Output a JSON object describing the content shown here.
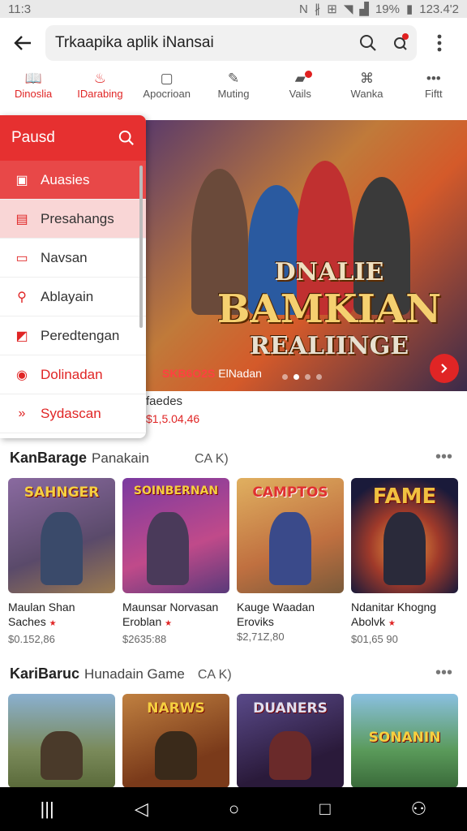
{
  "status": {
    "time": "11:3",
    "battery": "19%",
    "clock": "123.4'2"
  },
  "search": {
    "value": "Trkaapika aplik iNansai"
  },
  "tabs": [
    {
      "label": "Dinoslia",
      "icon": "book-icon"
    },
    {
      "label": "IDarabing",
      "icon": "flame-icon"
    },
    {
      "label": "Apocrioan",
      "icon": "square-icon"
    },
    {
      "label": "Muting",
      "icon": "pen-icon"
    },
    {
      "label": "Vails",
      "icon": "bag-icon"
    },
    {
      "label": "Wanka",
      "icon": "controller-icon"
    },
    {
      "label": "Fiftt",
      "icon": "more-icon"
    }
  ],
  "drawer": {
    "title": "Pausd",
    "items": [
      {
        "label": "Auasies",
        "icon": "document-icon"
      },
      {
        "label": "Presahangs",
        "icon": "tag-icon"
      },
      {
        "label": "Navsan",
        "icon": "folder-icon"
      },
      {
        "label": "Ablayain",
        "icon": "link-icon"
      },
      {
        "label": "Peredtengan",
        "icon": "chart-icon"
      },
      {
        "label": "Dolinadan",
        "icon": "record-icon"
      },
      {
        "label": "Sydascan",
        "icon": "arrows-icon"
      }
    ]
  },
  "hero": {
    "line1": "DNALIE",
    "line2": "BAMKIAN",
    "line3": "REALIINGE",
    "caption_red": "SKB6O2S",
    "caption": "ElNadan",
    "behind_text": "faedes",
    "behind_price": "$1,5.04,46",
    "colors": {
      "accent": "#e02525"
    }
  },
  "sections": [
    {
      "title": "KanBarage",
      "subtitle": "Panakain",
      "tag": "CA K)",
      "cards": [
        {
          "img_text": "SAHNGER",
          "name1": "Maulan  Shan",
          "name2": "Saches",
          "price": "$0.152,86",
          "bg": "#7a5a8a"
        },
        {
          "img_text": "SOINBERNAN",
          "name1": "Maunsar Norvasan",
          "name2": "Eroblan",
          "price": "$2635:88",
          "bg": "#8a4aa0"
        },
        {
          "img_text": "CAMPTOS",
          "name1": "Kauge Waadan",
          "name2": "Eroviks",
          "price": "$2,71Z,80",
          "bg": "#c88a40"
        },
        {
          "img_text": "FAME",
          "name1": "Ndanitar Khogng",
          "name2": "Abolvk",
          "price": "$01,65 90",
          "bg": "#2a1a3a"
        }
      ]
    },
    {
      "title": "KariBaruc",
      "subtitle": "Hunadain Game",
      "tag": "CA K)",
      "cards": [
        {
          "img_text": "",
          "bg": "#5a7a4a"
        },
        {
          "img_text": "NARWS",
          "bg": "#9a5a2a"
        },
        {
          "img_text": "DUANERS",
          "bg": "#4a3a6a"
        },
        {
          "img_text": "SONANIN",
          "bg": "#4a8a5a"
        }
      ]
    }
  ]
}
